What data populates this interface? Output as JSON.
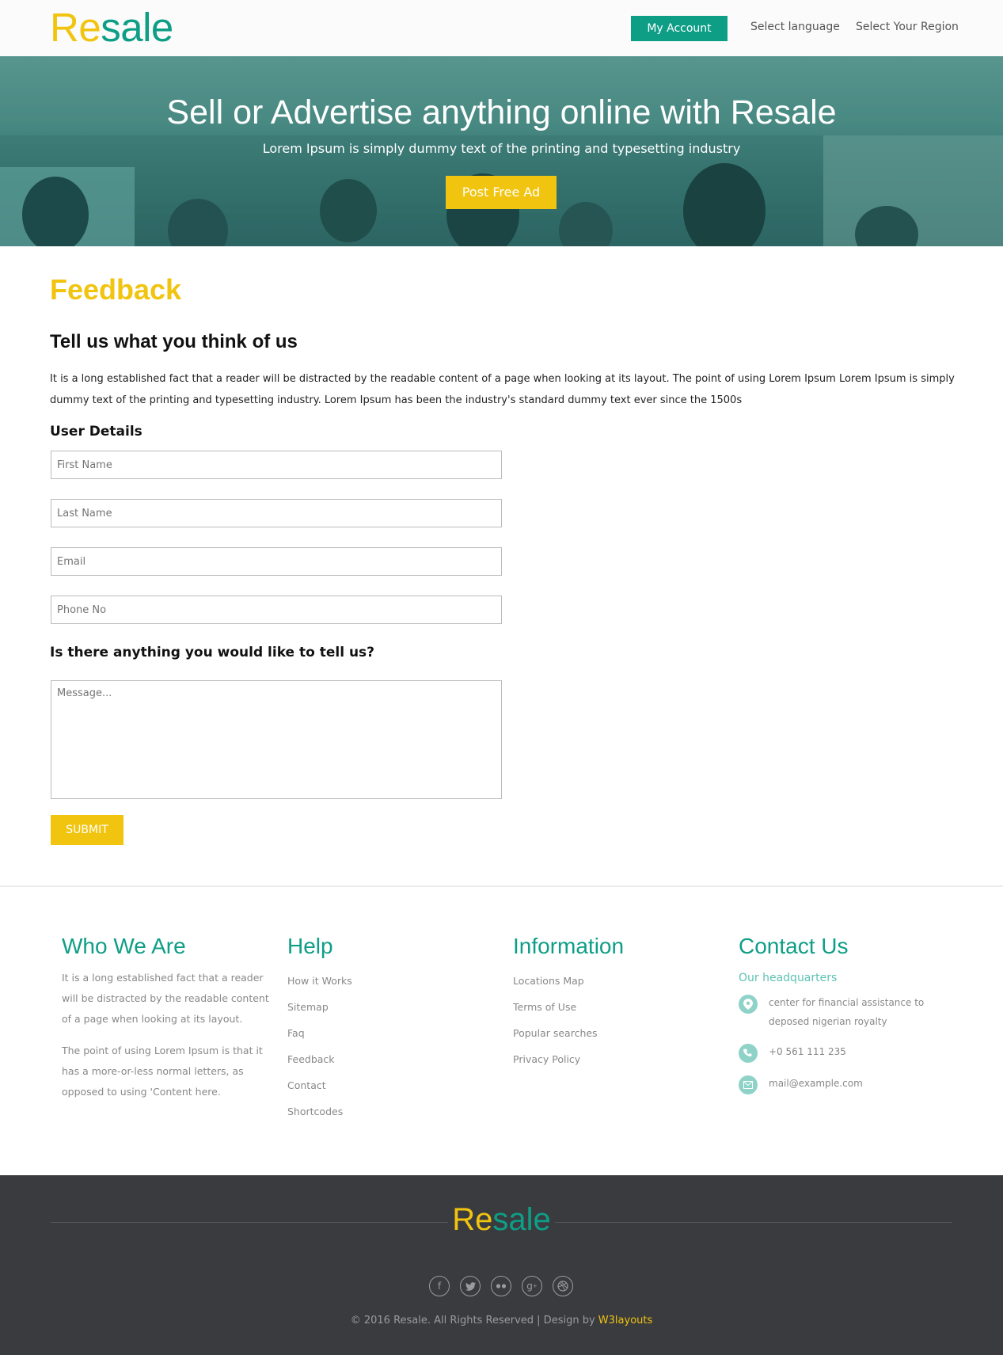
{
  "header": {
    "logo_re": "Re",
    "logo_sale": "sale",
    "account_label": "My Account",
    "language_label": "Select language",
    "region_label": "Select Your Region"
  },
  "banner": {
    "title": "Sell or Advertise anything online with Resale",
    "subtitle": "Lorem Ipsum is simply dummy text of the printing and typesetting industry",
    "cta_label": "Post Free Ad"
  },
  "feedback": {
    "heading": "Feedback",
    "subheading": "Tell us what you think of us",
    "intro": "It is a long established fact that a reader will be distracted by the readable content of a page when looking at its layout. The point of using Lorem Ipsum Lorem Ipsum is simply dummy text of the printing and typesetting industry. Lorem Ipsum has been the industry's standard dummy text ever since the 1500s",
    "user_details_label": "User Details",
    "first_name_placeholder": "First Name",
    "last_name_placeholder": "Last Name",
    "email_placeholder": "Email",
    "phone_placeholder": "Phone No",
    "question_label": "Is there anything you would like to tell us?",
    "message_placeholder": "Message...",
    "submit_label": "SUBMIT"
  },
  "footer": {
    "who": {
      "title": "Who We Are",
      "p1": "It is a long established fact that a reader will be distracted by the readable content of a page when looking at its layout.",
      "p2": "The point of using Lorem Ipsum is that it has a more-or-less normal letters, as opposed to using 'Content here."
    },
    "help": {
      "title": "Help",
      "links": [
        "How it Works",
        "Sitemap",
        "Faq",
        "Feedback",
        "Contact",
        "Shortcodes"
      ]
    },
    "info": {
      "title": "Information",
      "links": [
        "Locations Map",
        "Terms of Use",
        "Popular searches",
        "Privacy Policy"
      ]
    },
    "contact": {
      "title": "Contact Us",
      "hq": "Our headquarters",
      "address": "center for financial assistance to deposed nigerian royalty",
      "phone": "+0 561 111 235",
      "email": "mail@example.com"
    }
  },
  "bottom": {
    "logo_re": "Re",
    "logo_sale": "sale",
    "social_icons": [
      "facebook-icon",
      "twitter-icon",
      "flickr-icon",
      "google-plus-icon",
      "dribbble-icon"
    ],
    "copyright": "© 2016 Resale. All Rights Reserved | Design by",
    "designer": "W3layouts"
  },
  "colors": {
    "brand_yellow": "#f1c40f",
    "brand_teal": "#0e9e86",
    "footer_dark": "#3a3b3f"
  }
}
